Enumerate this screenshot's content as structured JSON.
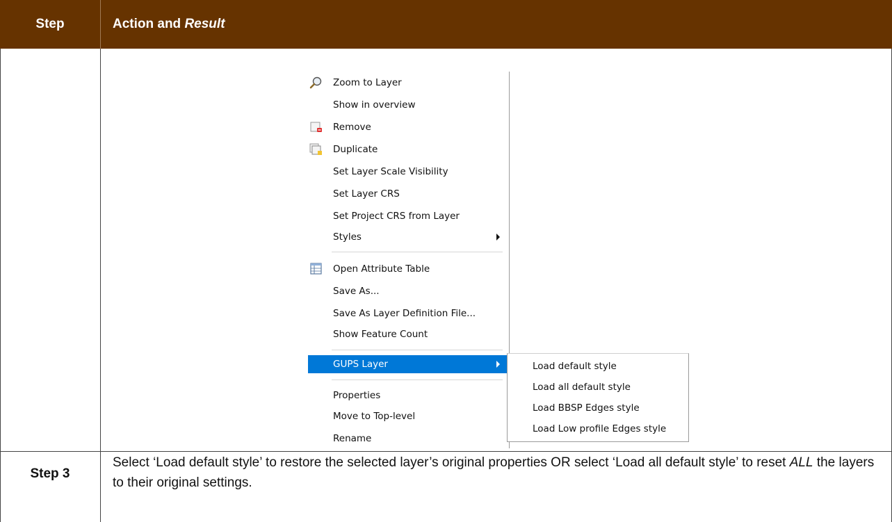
{
  "header": {
    "step_label": "Step",
    "action_label": "Action and ",
    "result_label": "Result"
  },
  "menu": {
    "items": [
      {
        "label": "Zoom to Layer",
        "icon": "zoom-icon"
      },
      {
        "label": "Show in overview"
      },
      {
        "label": "Remove",
        "icon": "remove-layer-icon"
      },
      {
        "label": "Duplicate",
        "icon": "duplicate-layer-icon"
      },
      {
        "label": "Set Layer Scale Visibility"
      },
      {
        "label": "Set Layer CRS"
      },
      {
        "label": "Set Project CRS from Layer"
      },
      {
        "label": "Styles",
        "submenu": true
      },
      {
        "label": "Open Attribute Table",
        "icon": "attribute-table-icon"
      },
      {
        "label": "Save As..."
      },
      {
        "label": "Save As Layer Definition File..."
      },
      {
        "label": "Show Feature Count"
      },
      {
        "label": "GUPS Layer",
        "submenu": true,
        "highlighted": true
      },
      {
        "label": "Properties"
      },
      {
        "label": "Move to Top-level"
      },
      {
        "label": "Rename"
      }
    ],
    "highlight_color": "#0078d7"
  },
  "submenu": {
    "items": [
      "Load default style",
      "Load all default style",
      "Load BBSP Edges style",
      "Load Low profile Edges style"
    ]
  },
  "step3": {
    "step_label": "Step 3",
    "text_before": "Select ‘Load default style’ to restore the selected layer’s original properties OR select ‘Load all default style’ to reset ",
    "text_em": "ALL",
    "text_after": " the layers to their original settings."
  },
  "colors": {
    "header_bg": "#663300",
    "header_text": "#ffffff"
  }
}
